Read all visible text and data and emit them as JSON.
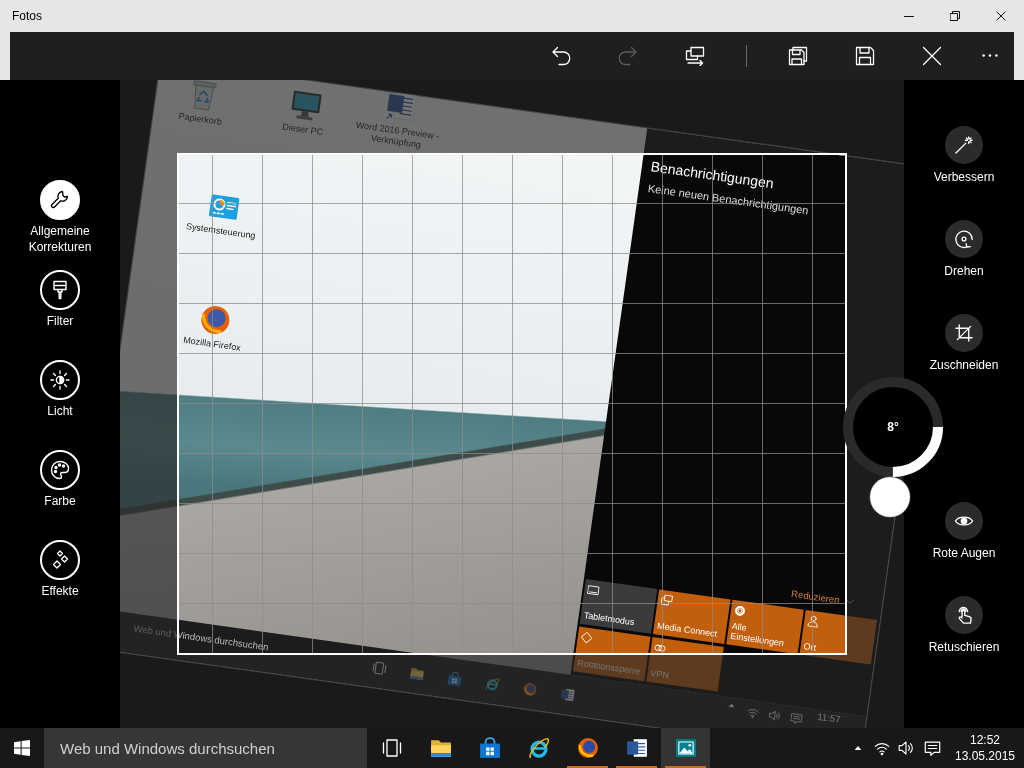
{
  "window": {
    "title": "Fotos"
  },
  "toolbar": [
    {
      "disabled": false
    },
    {
      "disabled": true
    },
    {
      "disabled": false
    },
    {
      "disabled": false
    },
    {
      "disabled": false
    },
    {
      "disabled": false
    },
    {
      "disabled": false
    }
  ],
  "categories": [
    {
      "label": "Allgemeine Korrekturen",
      "selected": true
    },
    {
      "label": "Filter",
      "selected": false
    },
    {
      "label": "Licht",
      "selected": false
    },
    {
      "label": "Farbe",
      "selected": false
    },
    {
      "label": "Effekte",
      "selected": false
    }
  ],
  "photo": {
    "desktop_icons": [
      {
        "label": "Papierkorb"
      },
      {
        "label": "Dieser PC"
      },
      {
        "label": "Word 2016 Preview - Verknüpfung"
      },
      {
        "label": "Systemsteuerung"
      },
      {
        "label": "Mozilla Firefox"
      }
    ],
    "notifications": {
      "title": "Benachrichtigungen",
      "message": "Keine neuen Benachrichtigungen",
      "collapse": "Reduzieren",
      "tiles": [
        {
          "label": "Tabletmodus",
          "on": false
        },
        {
          "label": "Media Connect",
          "on": true
        },
        {
          "label": "Alle Einstellungen",
          "on": true
        },
        {
          "label": "Ort",
          "on": true
        },
        {
          "label": "Rotationssperre",
          "on": true
        },
        {
          "label": "VPN",
          "on": true
        }
      ]
    },
    "taskbar": {
      "search_text": "Web und Windows durchsuchen",
      "clock": "11:57"
    }
  },
  "rotation": {
    "angle": "8°",
    "level": 0.25
  },
  "tools": [
    {
      "label": "Verbessern"
    },
    {
      "label": "Drehen"
    },
    {
      "label": "Zuschneiden"
    },
    {
      "label": "Rote Augen"
    },
    {
      "label": "Retuschieren"
    }
  ],
  "taskbar": {
    "search": {
      "placeholder": "Web und Windows durchsuchen"
    },
    "apps": [
      {
        "running": false,
        "selected": false
      },
      {
        "running": false,
        "selected": false
      },
      {
        "running": false,
        "selected": false
      },
      {
        "running": true,
        "selected": false
      },
      {
        "running": true,
        "selected": false
      },
      {
        "running": true,
        "selected": true
      }
    ],
    "clock": {
      "time": "12:52",
      "date": "13.05.2015"
    }
  }
}
